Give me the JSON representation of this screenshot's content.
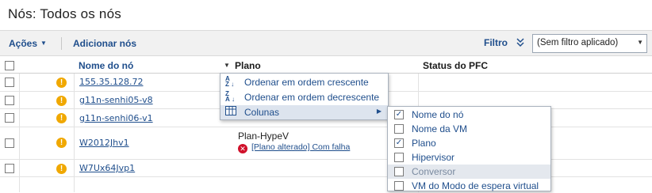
{
  "page": {
    "title": "Nós:  Todos os nós"
  },
  "toolbar": {
    "actions_label": "Ações",
    "add_nodes_label": "Adicionar nós",
    "filter_label": "Filtro",
    "filter_value": "(Sem filtro aplicado)"
  },
  "table": {
    "headers": {
      "node_name": "Nome do nó",
      "plan": "Plano",
      "pfc_status": "Status do PFC"
    },
    "rows": [
      {
        "name": "155.35.128.72",
        "plan": "",
        "status": ""
      },
      {
        "name": "g11n-senhi05-v8",
        "plan": "",
        "status": ""
      },
      {
        "name": "g11n-senhi06-v1",
        "plan": "",
        "status": ""
      },
      {
        "name": "W2012Jhv1",
        "plan": "Plan-HypeV",
        "status": "[Plano alterado] Com falha"
      },
      {
        "name": "W7Ux64Jvp1",
        "plan": "",
        "status": ""
      }
    ]
  },
  "column_menu": {
    "sort_asc": "Ordenar em ordem crescente",
    "sort_desc": "Ordenar em ordem decrescente",
    "columns": "Colunas"
  },
  "columns_submenu": [
    {
      "label": "Nome do nó",
      "checked": true
    },
    {
      "label": "Nome da VM",
      "checked": false
    },
    {
      "label": "Plano",
      "checked": true
    },
    {
      "label": "Hipervisor",
      "checked": false
    },
    {
      "label": "Conversor",
      "checked": false
    },
    {
      "label": "VM do Modo de espera virtual",
      "checked": false
    }
  ],
  "colors": {
    "link": "#1f4e8c",
    "warning": "#f0a800",
    "error": "#d0102a"
  }
}
